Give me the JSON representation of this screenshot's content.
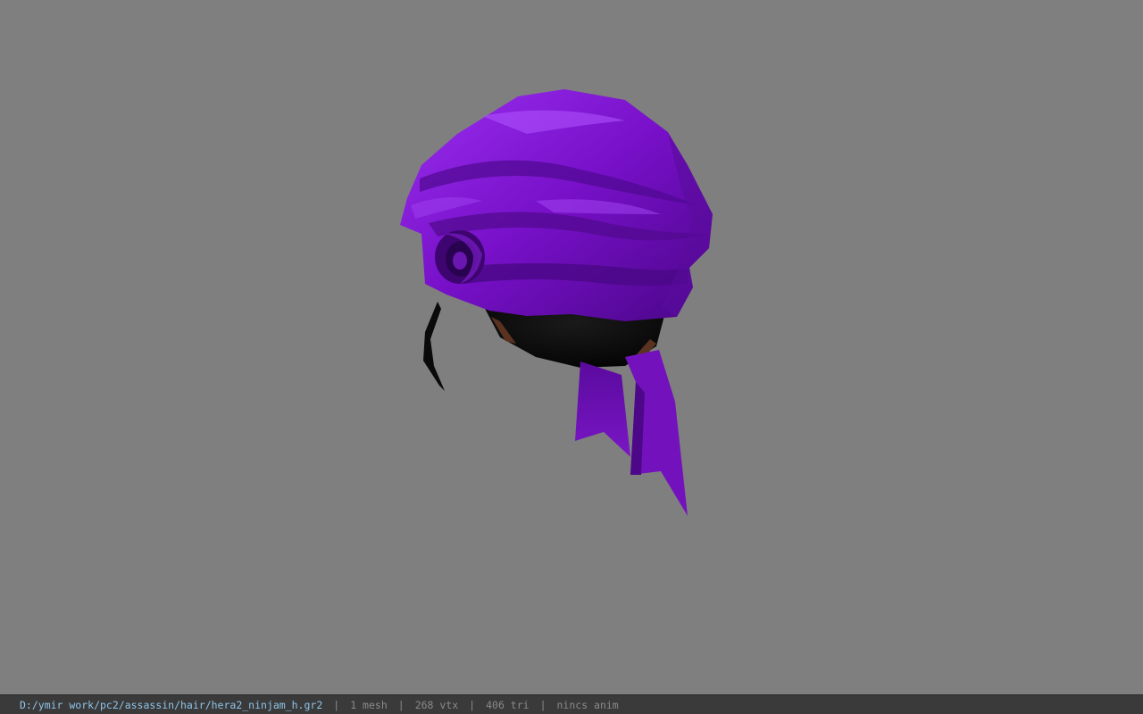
{
  "viewer": {
    "background_color": "#7f7f7f",
    "model": {
      "name": "purple ninja head wrap",
      "primary_color": "#7a10c8",
      "shadow_color": "#3e0470",
      "highlight_color": "#a040f0"
    }
  },
  "status_bar": {
    "file_path": "D:/ymir work/pc2/assassin/hair/hera2_ninjam_h.gr2",
    "separator": "|",
    "mesh_count": "1 mesh",
    "vertex_count": "268 vtx",
    "triangle_count": "406 tri",
    "anim_status": "nincs anim"
  }
}
